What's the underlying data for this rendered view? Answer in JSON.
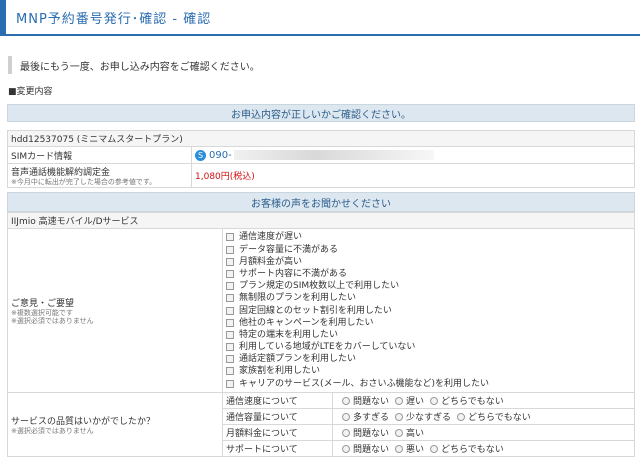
{
  "page": {
    "title": "MNP予約番号発行･確認 - 確認"
  },
  "notice": "最後にもう一度、お申し込み内容をご確認ください。",
  "section_label": "■変更内容",
  "confirm_band": "お申込内容が正しいかご確認ください。",
  "contract": {
    "plan_id": "hdd12537075 (ミニマムスタートプラン)",
    "sim_label": "SIMカード情報",
    "phone_prefix": "090-",
    "fee_label": "音声通話機能解約調定金",
    "fee_note": "※今月中に転出が完了した場合の参考値です。",
    "fee_value": "1,080円(税込)"
  },
  "voice_band": "お客様の声をお聞かせください",
  "service_name": "IIJmio 高速モバイル/Dサービス",
  "feedback": {
    "label": "ご意見・ご要望",
    "note1": "※複数選択可能です",
    "note2": "※選択必須ではありません",
    "options": [
      "通信速度が遅い",
      "データ容量に不満がある",
      "月額料金が高い",
      "サポート内容に不満がある",
      "プラン規定のSIM枚数以上で利用したい",
      "無制限のプランを利用したい",
      "固定回線とのセット割引を利用したい",
      "他社のキャンペーンを利用したい",
      "特定の端末を利用したい",
      "利用している地域がLTEをカバーしていない",
      "通話定額プランを利用したい",
      "家族割を利用したい",
      "キャリアのサービス(メール、おさいふ機能など)を利用したい"
    ]
  },
  "quality": {
    "label": "サービスの品質はいかがでしたか？",
    "note": "※選択必須ではありません",
    "rows": [
      {
        "item": "通信速度について",
        "choices": [
          "問題ない",
          "遅い",
          "どちらでもない"
        ]
      },
      {
        "item": "通信容量について",
        "choices": [
          "多すぎる",
          "少なすぎる",
          "どちらでもない"
        ]
      },
      {
        "item": "月額料金について",
        "choices": [
          "問題ない",
          "高い"
        ]
      },
      {
        "item": "サポートについて",
        "choices": [
          "問題ない",
          "悪い",
          "どちらでもない"
        ]
      }
    ]
  },
  "colors": {
    "accent": "#2a6db0",
    "band_bg": "#dde7ef",
    "price": "#d01010"
  }
}
